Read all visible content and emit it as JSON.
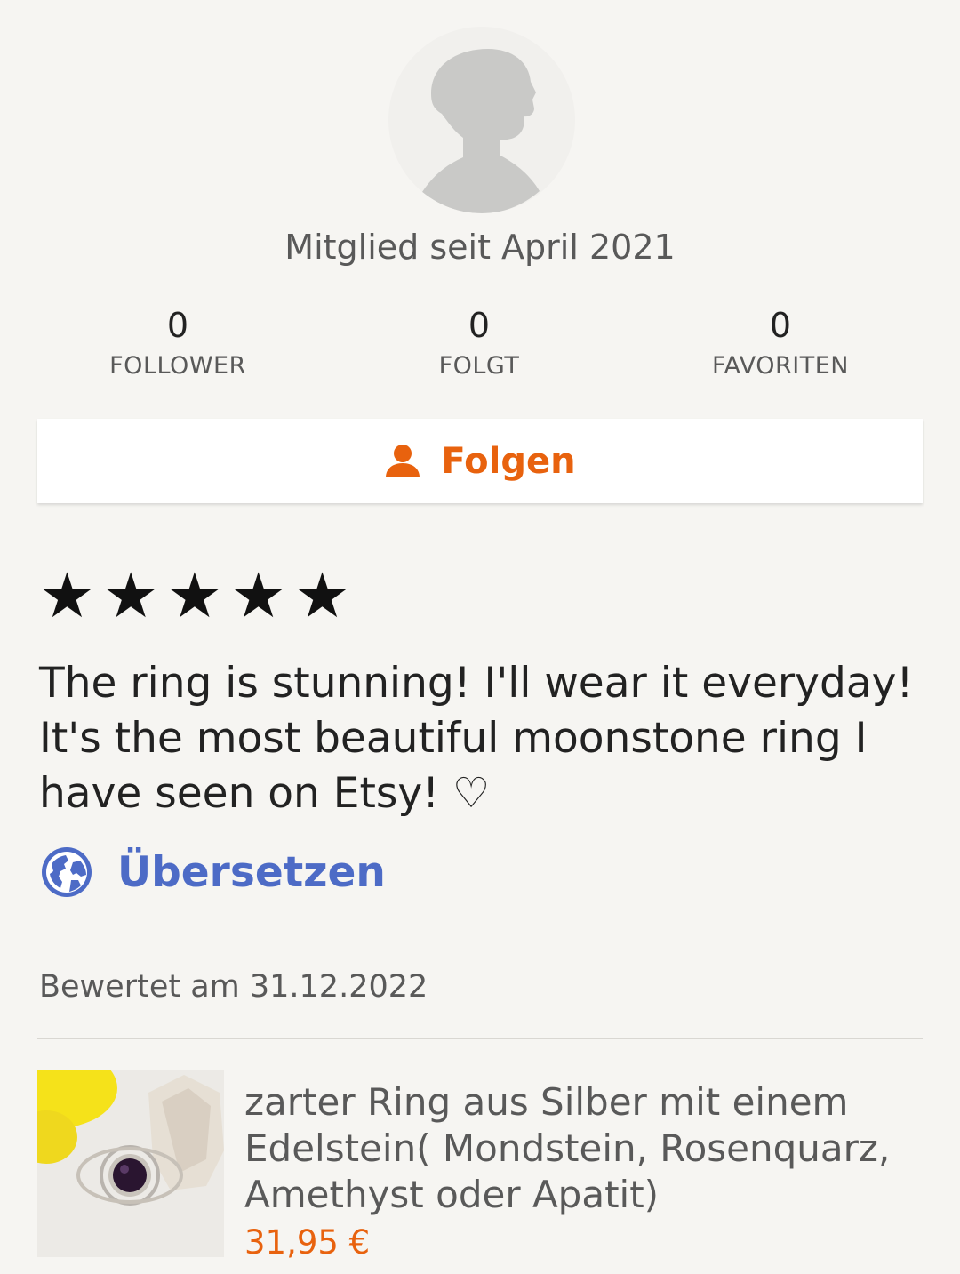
{
  "profile": {
    "avatar_icon": "default-avatar-silhouette-icon",
    "member_since": "Mitglied seit April 2021"
  },
  "stats": [
    {
      "value": "0",
      "label": "FOLLOWER"
    },
    {
      "value": "0",
      "label": "FOLGT"
    },
    {
      "value": "0",
      "label": "FAVORITEN"
    }
  ],
  "follow_button": {
    "label": "Folgen",
    "icon": "person-icon"
  },
  "review": {
    "rating": 5,
    "rating_max": 5,
    "stars": [
      "★",
      "★",
      "★",
      "★",
      "★"
    ],
    "text": "The ring is stunning! I'll wear it everyday! It's the most beautiful moonstone ring I have seen on Etsy! ♡",
    "translate_label": "Übersetzen",
    "translate_icon": "globe-icon",
    "reviewed_on": "Bewertet am 31.12.2022"
  },
  "product": {
    "title": "zarter Ring aus Silber mit einem Edelstein( Mondstein, Rosenquarz, Amethyst oder Apatit)",
    "price": "31,95 €"
  },
  "colors": {
    "background": "#f6f5f2",
    "accent_orange": "#e8620e",
    "link_blue": "#4d6bc6",
    "text_primary": "#222222",
    "text_secondary": "#595959"
  }
}
